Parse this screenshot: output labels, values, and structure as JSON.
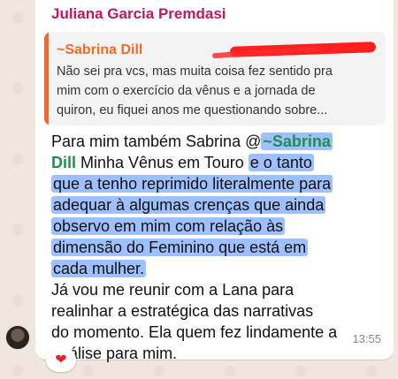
{
  "message": {
    "sender": "Juliana Garcia Premdasi",
    "quoted": {
      "author": "~Sabrina Dill",
      "text_lines": [
        "Não sei pra vcs, mas muita coisa fez sentido pra",
        "mim com o exercício da vênus e a jornada de",
        "quiron, eu fiquei anos me questionando sobre..."
      ]
    },
    "body": {
      "line1_a": "Para mim também Sabrina @",
      "line1_mention": "~Sabrina",
      "line2_mention": "Dill",
      "line2_a": " Minha Vênus em Touro ",
      "line2_hl": "e o tanto",
      "hl_lines": [
        "que a tenho reprimido literalmente para",
        "adequar à algumas crenças que ainda",
        "observo em mim com relação às",
        "dimensão do Feminino que está em",
        "cada mulher."
      ],
      "rest_lines": [
        "Já vou me reunir com a Lana para",
        "realinhar a estratégica das narrativas",
        "do momento. Ela quem fez lindamente a",
        "análise para mim."
      ]
    },
    "time": "13:55",
    "reaction": "❤"
  },
  "colors": {
    "sender": "#c2185b",
    "quote_accent": "#f06a2a",
    "mention": "#1e8f4e",
    "highlight": "#6e9cff"
  }
}
